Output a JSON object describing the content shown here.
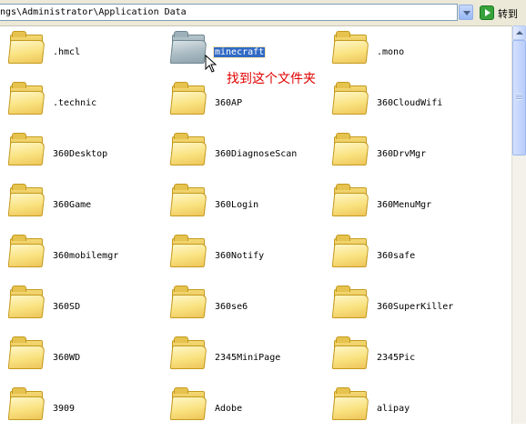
{
  "address_bar": {
    "path": "ngs\\Administrator\\Application Data",
    "go_label": "转到"
  },
  "annotation": "找到这个文件夹",
  "selected_item": "minecraft",
  "items": [
    ".hmcl",
    "minecraft",
    ".mono",
    ".technic",
    "360AP",
    "360CloudWifi",
    "360Desktop",
    "360DiagnoseScan",
    "360DrvMgr",
    "360Game",
    "360Login",
    "360MenuMgr",
    "360mobilemgr",
    "360Notify",
    "360safe",
    "360SD",
    "360se6",
    "360SuperKiller",
    "360WD",
    "2345MiniPage",
    "2345Pic",
    "3909",
    "Adobe",
    "alipay"
  ],
  "colors": {
    "annotation": "#e00000",
    "selection": "#316ac5",
    "folder": "#f9e27f"
  },
  "icons": {
    "folder": "folder-icon",
    "dropdown": "chevron-down-icon",
    "go": "go-arrow-icon",
    "cursor": "mouse-pointer-icon"
  }
}
